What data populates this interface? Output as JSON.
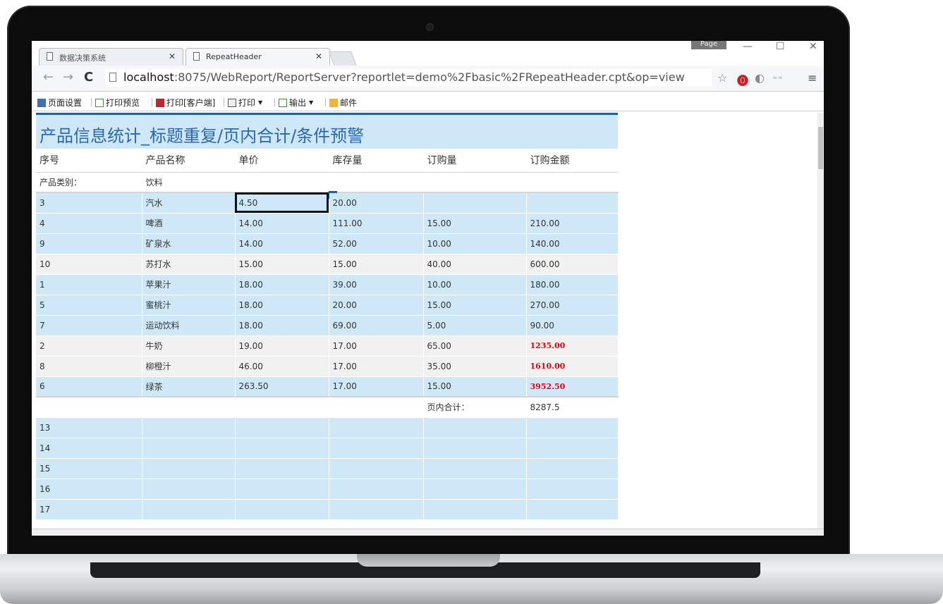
{
  "browser": {
    "page_badge": "Page",
    "tabs": [
      {
        "label": "数据决策系统",
        "active": false
      },
      {
        "label": "RepeatHeader",
        "active": true
      }
    ],
    "url_host": "localhost",
    "url_rest": ":8075/WebReport/ReportServer?reportlet=demo%2Fbasic%2FRepeatHeader.cpt&op=view",
    "win_controls": {
      "minimize": "—",
      "maximize": "☐",
      "close": "✕"
    }
  },
  "report_toolbar": {
    "items": [
      "页面设置",
      "打印预览",
      "打印[客户端]",
      "打印",
      "输出",
      "邮件"
    ]
  },
  "report": {
    "title": "产品信息统计_标题重复/页内合计/条件预警",
    "headers": [
      "序号",
      "产品名称",
      "单价",
      "库存量",
      "订购量",
      "订购金额"
    ],
    "category_label": "产品类别：",
    "category_value": "饮料",
    "rows": [
      {
        "no": "3",
        "name": "汽水",
        "price": "4.50",
        "stock": "20.00",
        "qty": "",
        "amount": "",
        "style": "blue",
        "warn": false
      },
      {
        "no": "4",
        "name": "啤酒",
        "price": "14.00",
        "stock": "111.00",
        "qty": "15.00",
        "amount": "210.00",
        "style": "blue",
        "warn": false
      },
      {
        "no": "9",
        "name": "矿泉水",
        "price": "14.00",
        "stock": "52.00",
        "qty": "10.00",
        "amount": "140.00",
        "style": "blue",
        "warn": false
      },
      {
        "no": "10",
        "name": "苏打水",
        "price": "15.00",
        "stock": "15.00",
        "qty": "40.00",
        "amount": "600.00",
        "style": "grey",
        "warn": false
      },
      {
        "no": "1",
        "name": "苹果汁",
        "price": "18.00",
        "stock": "39.00",
        "qty": "10.00",
        "amount": "180.00",
        "style": "blue",
        "warn": false
      },
      {
        "no": "5",
        "name": "蜜桃汁",
        "price": "18.00",
        "stock": "20.00",
        "qty": "15.00",
        "amount": "270.00",
        "style": "blue",
        "warn": false
      },
      {
        "no": "7",
        "name": "运动饮料",
        "price": "18.00",
        "stock": "69.00",
        "qty": "5.00",
        "amount": "90.00",
        "style": "blue",
        "warn": false
      },
      {
        "no": "2",
        "name": "牛奶",
        "price": "19.00",
        "stock": "17.00",
        "qty": "65.00",
        "amount": "1235.00",
        "style": "grey",
        "warn": true
      },
      {
        "no": "8",
        "name": "柳橙汁",
        "price": "46.00",
        "stock": "17.00",
        "qty": "35.00",
        "amount": "1610.00",
        "style": "grey",
        "warn": true
      },
      {
        "no": "6",
        "name": "绿茶",
        "price": "263.50",
        "stock": "17.00",
        "qty": "15.00",
        "amount": "3952.50",
        "style": "blue",
        "warn": true
      }
    ],
    "total_label": "页内合计：",
    "total_value": "8287.5",
    "blank_rows": [
      "13",
      "14",
      "15",
      "16",
      "17"
    ],
    "colors": {
      "header_blue": "#cfe8f7",
      "title_text": "#2a67b8",
      "warning": "#e60012"
    }
  }
}
